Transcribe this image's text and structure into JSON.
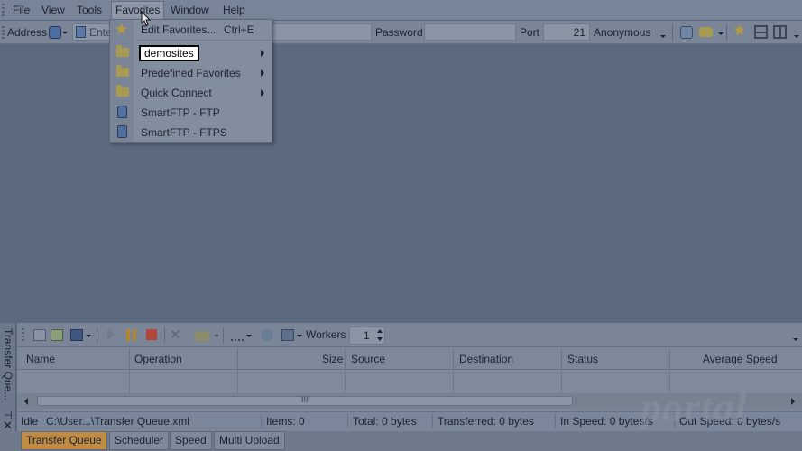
{
  "menubar": {
    "items": [
      {
        "label": "File"
      },
      {
        "label": "View"
      },
      {
        "label": "Tools"
      },
      {
        "label": "Favorites"
      },
      {
        "label": "Window"
      },
      {
        "label": "Help"
      }
    ]
  },
  "addressbar": {
    "address_label": "Address",
    "host_placeholder": "Ente",
    "password_label": "Password",
    "port_label": "Port",
    "port_value": "21",
    "anonymous_label": "Anonymous"
  },
  "favorites_menu": {
    "items": [
      {
        "label": "Edit Favorites...",
        "shortcut": "Ctrl+E",
        "icon": "star-icon"
      },
      {
        "label": "demosites",
        "icon": "folder-icon",
        "submenu": true
      },
      {
        "label": "Predefined Favorites",
        "icon": "folder-icon",
        "submenu": true
      },
      {
        "label": "Quick Connect",
        "icon": "folder-icon",
        "submenu": true
      },
      {
        "label": "SmartFTP - FTP",
        "icon": "ftp-icon"
      },
      {
        "label": "SmartFTP - FTPS",
        "icon": "ftps-icon"
      }
    ]
  },
  "transfer_queue": {
    "side_title": "Transfer Que...",
    "workers_label": "Workers",
    "workers_value": "1",
    "columns": [
      "Name",
      "Operation",
      "Size",
      "Source",
      "Destination",
      "Status",
      "Average Speed"
    ],
    "status": {
      "state": "Idle",
      "path": "C:\\User...\\Transfer Queue.xml",
      "items": "Items: 0",
      "total": "Total: 0 bytes",
      "transferred": "Transferred: 0 bytes",
      "in_speed": "In Speed: 0 bytes/s",
      "out_speed": "Out Speed: 0 bytes/s"
    }
  },
  "bottom_tabs": [
    {
      "label": "Transfer Queue",
      "active": true
    },
    {
      "label": "Scheduler",
      "active": false
    },
    {
      "label": "Speed",
      "active": false
    },
    {
      "label": "Multi Upload",
      "active": false
    }
  ],
  "watermark": {
    "text": "portal"
  },
  "colors": {
    "background": "#5b6a7f",
    "active_tab": "#c08c43",
    "highlight": "#ffffff"
  }
}
